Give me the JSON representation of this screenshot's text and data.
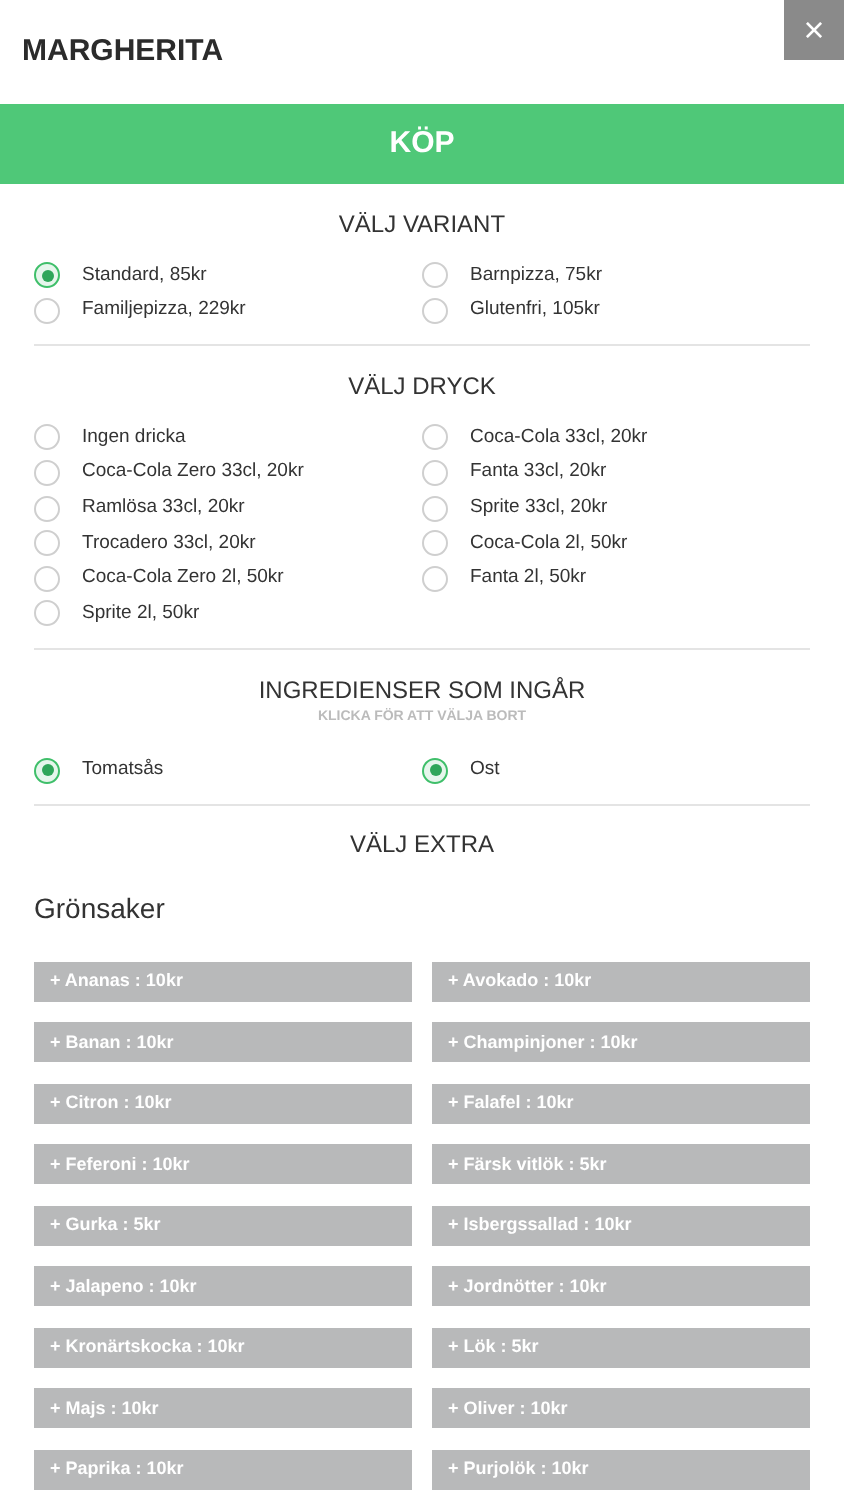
{
  "header": {
    "title": "MARGHERITA",
    "close": "×"
  },
  "buy_button": "KÖP",
  "sections": [
    {
      "title": "VÄLJ VARIANT",
      "options": [
        {
          "label": "Standard, 85kr",
          "selected": true
        },
        {
          "label": "Barnpizza, 75kr",
          "selected": false
        },
        {
          "label": "Familjepizza, 229kr",
          "selected": false
        },
        {
          "label": "Glutenfri, 105kr",
          "selected": false
        }
      ]
    },
    {
      "title": "VÄLJ DRYCK",
      "options": [
        {
          "label": "Ingen dricka",
          "selected": false
        },
        {
          "label": "Coca-Cola 33cl, 20kr",
          "selected": false
        },
        {
          "label": "Coca-Cola Zero 33cl, 20kr",
          "selected": false
        },
        {
          "label": "Fanta 33cl, 20kr",
          "selected": false
        },
        {
          "label": "Ramlösa 33cl, 20kr",
          "selected": false
        },
        {
          "label": "Sprite 33cl, 20kr",
          "selected": false
        },
        {
          "label": "Trocadero 33cl, 20kr",
          "selected": false
        },
        {
          "label": "Coca-Cola 2l, 50kr",
          "selected": false
        },
        {
          "label": "Coca-Cola Zero 2l, 50kr",
          "selected": false
        },
        {
          "label": "Fanta 2l, 50kr",
          "selected": false
        },
        {
          "label": "Sprite 2l, 50kr",
          "selected": false
        }
      ]
    },
    {
      "title": "INGREDIENSER SOM INGÅR",
      "subtitle": "KLICKA FÖR ATT VÄLJA BORT",
      "options": [
        {
          "label": "Tomatsås",
          "selected": true
        },
        {
          "label": "Ost",
          "selected": true
        }
      ]
    }
  ],
  "extra": {
    "title": "VÄLJ EXTRA",
    "category": "Grönsaker",
    "items": [
      "+ Ananas : 10kr",
      "+ Avokado : 10kr",
      "+ Banan : 10kr",
      "+ Champinjoner : 10kr",
      "+ Citron : 10kr",
      "+ Falafel : 10kr",
      "+ Feferoni : 10kr",
      "+ Färsk vitlök : 5kr",
      "+ Gurka : 5kr",
      "+ Isbergssallad : 10kr",
      "+ Jalapeno : 10kr",
      "+ Jordnötter : 10kr",
      "+ Kronärtskocka : 10kr",
      "+ Lök : 5kr",
      "+ Majs : 10kr",
      "+ Oliver : 10kr",
      "+ Paprika : 10kr",
      "+ Purjolök : 10kr"
    ]
  }
}
